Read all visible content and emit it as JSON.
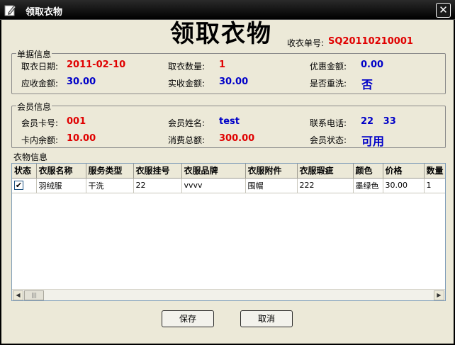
{
  "window": {
    "title": "领取衣物",
    "close_glyph": "✕"
  },
  "header": {
    "title": "领取衣物",
    "order_no_label": "收衣单号:",
    "order_no": "SQ20110210001"
  },
  "receipt": {
    "legend": "单据信息",
    "pickup_date_label": "取衣日期:",
    "pickup_date": "2011-02-10",
    "pickup_qty_label": "取衣数量:",
    "pickup_qty": "1",
    "discount_label": "优惠金额:",
    "discount": "0.00",
    "receivable_label": "应收金额:",
    "receivable": "30.00",
    "received_label": "实收金额:",
    "received": "30.00",
    "rewash_label": "是否重洗:",
    "rewash": "否"
  },
  "member": {
    "legend": "会员信息",
    "card_no_label": "会员卡号:",
    "card_no": "001",
    "name_label": "会员姓名:",
    "name": "test",
    "phone_label": "联系电话:",
    "phone": "22   33",
    "balance_label": "卡内余额:",
    "balance": "10.00",
    "total_spent_label": "消费总额:",
    "total_spent": "300.00",
    "status_label": "会员状态:",
    "status": "可用"
  },
  "clothes": {
    "legend": "衣物信息",
    "columns": [
      "状态",
      "衣服名称",
      "服务类型",
      "衣服挂号",
      "衣服品牌",
      "衣服附件",
      "衣服瑕疵",
      "颜色",
      "价格",
      "数量"
    ],
    "rows": [
      {
        "checked": true,
        "check_glyph": "✔",
        "cells": [
          "羽绒服",
          "干洗",
          "22",
          "vvvv",
          "围帽",
          "222",
          "墨绿色",
          "30.00",
          "1"
        ]
      }
    ]
  },
  "buttons": {
    "save": "保存",
    "cancel": "取消"
  },
  "icons": {
    "app": "edit-pencil-icon",
    "close": "close-icon",
    "scroll_left": "◀",
    "scroll_right": "▶",
    "thumb_grip": "|||"
  }
}
